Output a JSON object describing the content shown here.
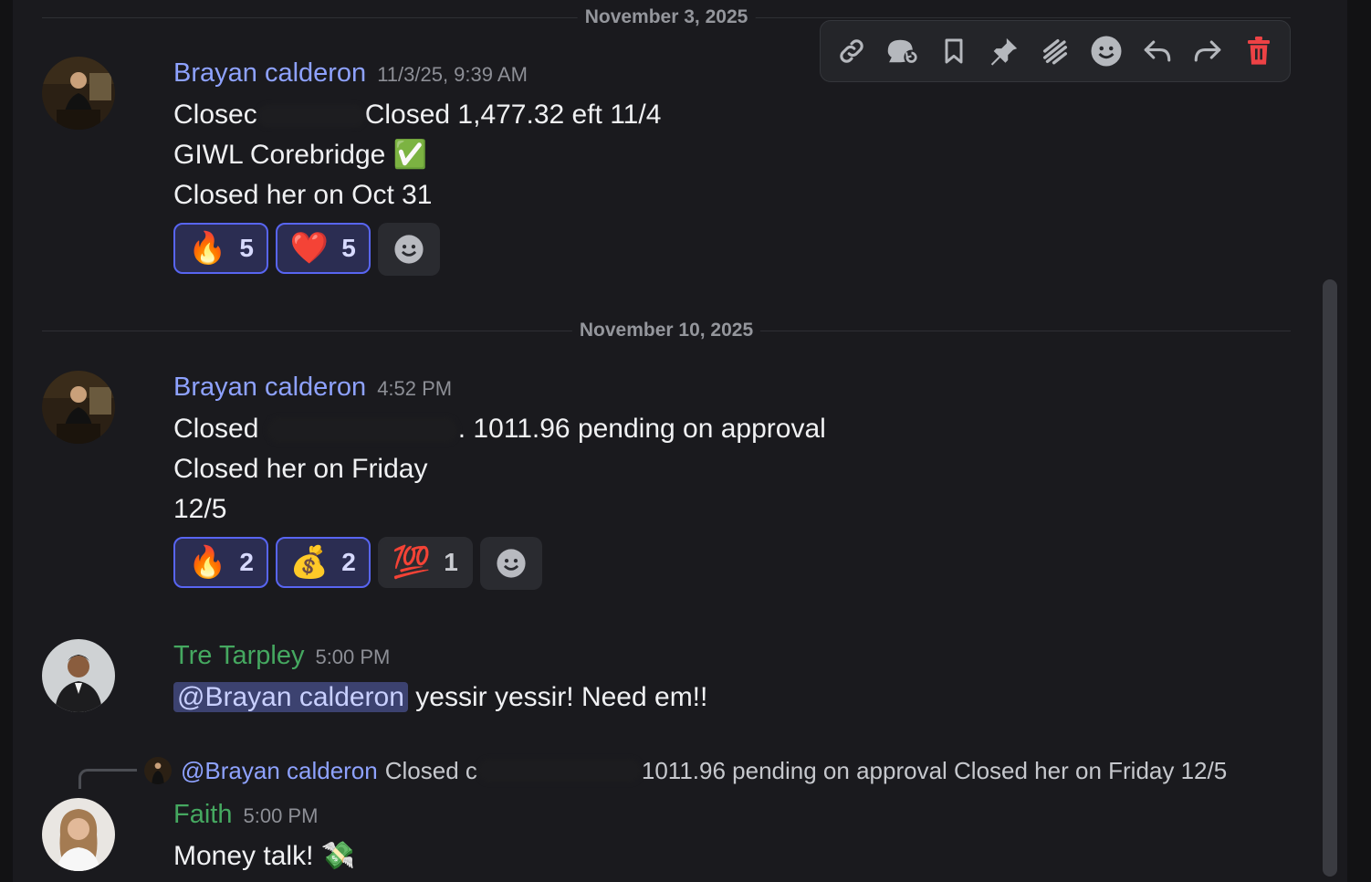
{
  "dividers": [
    {
      "label": "November 3, 2025"
    },
    {
      "label": "November 10, 2025"
    }
  ],
  "toolbar": {
    "icons": [
      "link-icon",
      "thread-icon",
      "bookmark-icon",
      "pin-icon",
      "mark-unread-icon",
      "reaction-icon",
      "reply-icon",
      "forward-icon",
      "trash-icon"
    ],
    "danger_color": "#ed4245"
  },
  "messages": [
    {
      "author": "Brayan calderon",
      "timestamp": "11/3/25, 9:39 AM",
      "lines": {
        "l1_a": "Closec",
        "l1_b": "Closed 1,477.32 eft 11/4",
        "l2": "GIWL Corebridge",
        "l2_emoji": "✅",
        "l3": "Closed her on Oct 31"
      },
      "reactions": [
        {
          "emoji": "🔥",
          "count": "5"
        },
        {
          "emoji": "❤️",
          "count": "5"
        }
      ]
    },
    {
      "author": "Brayan calderon",
      "timestamp": "4:52 PM",
      "lines": {
        "l1_a": "Closed ",
        "l1_b": ". 1011.96 pending on approval",
        "l2": "Closed her on Friday",
        "l3": "12/5"
      },
      "reactions": [
        {
          "emoji": "🔥",
          "count": "2"
        },
        {
          "emoji": "💰",
          "count": "2"
        },
        {
          "emoji": "💯",
          "count": "1"
        }
      ]
    },
    {
      "author": "Tre Tarpley",
      "timestamp": "5:00 PM",
      "mention": "@Brayan calderon",
      "text": "yessir yessir! Need em!!"
    },
    {
      "reply": {
        "mention": "@Brayan calderon",
        "text_a": "Closed c",
        "text_b": "1011.96 pending on approval Closed her on Friday  12/5"
      },
      "author": "Faith",
      "timestamp": "5:00 PM",
      "text": "Money talk!",
      "emoji": "💸"
    }
  ]
}
